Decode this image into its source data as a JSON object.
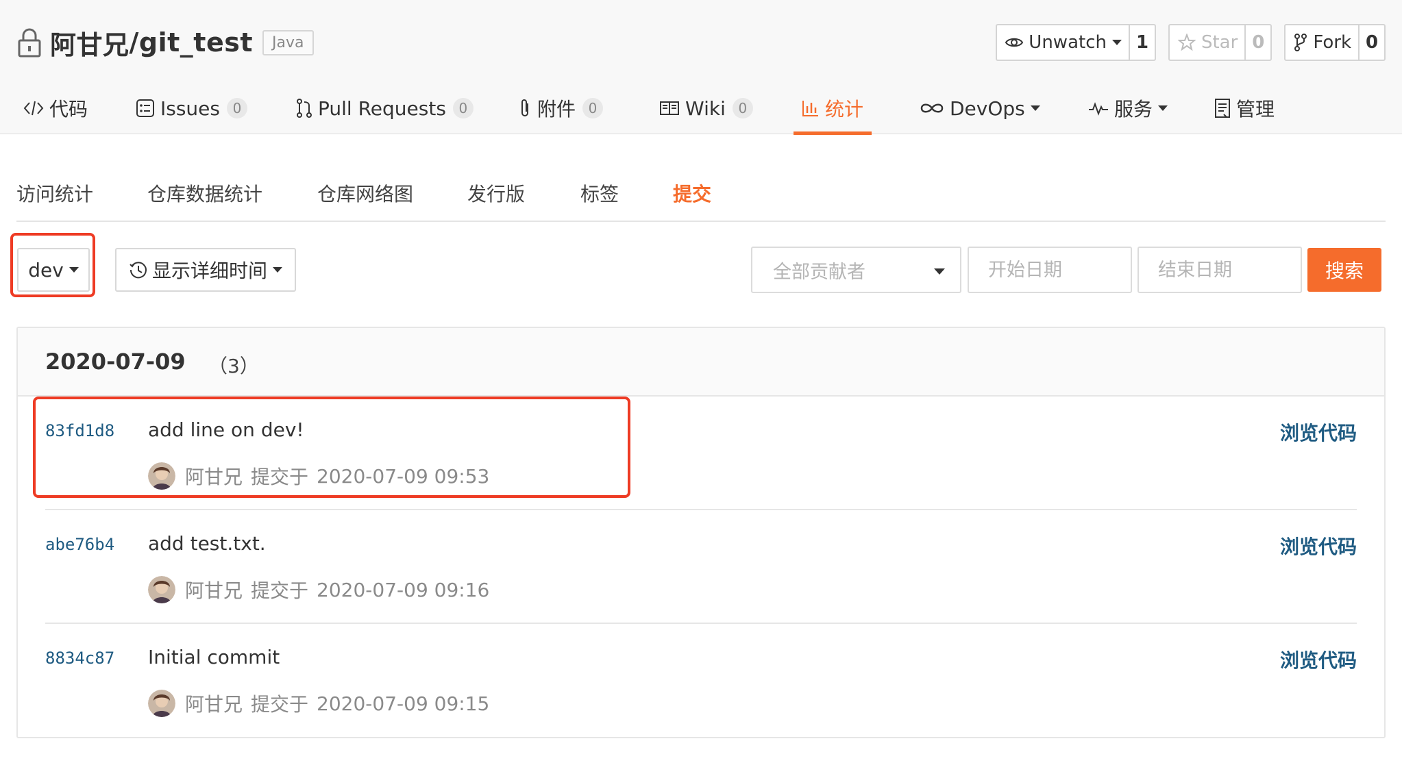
{
  "repo": {
    "owner": "阿甘兄",
    "separator": " / ",
    "name": "git_test",
    "language": "Java"
  },
  "actions": {
    "watch": {
      "label": "Unwatch",
      "count": "1"
    },
    "star": {
      "label": "Star",
      "count": "0"
    },
    "fork": {
      "label": "Fork",
      "count": "0"
    }
  },
  "tabs": [
    {
      "label": "代码",
      "icon": "code-icon"
    },
    {
      "label": "Issues",
      "badge": "0",
      "icon": "issues-icon"
    },
    {
      "label": "Pull Requests",
      "badge": "0",
      "icon": "pull-request-icon"
    },
    {
      "label": "附件",
      "badge": "0",
      "icon": "paperclip-icon"
    },
    {
      "label": "Wiki",
      "badge": "0",
      "icon": "book-icon"
    },
    {
      "label": "统计",
      "icon": "bar-chart-icon",
      "active": true
    },
    {
      "label": "DevOps",
      "icon": "infinity-icon"
    },
    {
      "label": "服务",
      "icon": "pulse-icon"
    },
    {
      "label": "管理",
      "icon": "document-icon"
    }
  ],
  "subnav": [
    "访问统计",
    "仓库数据统计",
    "仓库网络图",
    "发行版",
    "标签",
    "提交"
  ],
  "toolbar": {
    "branch": "dev",
    "time_toggle": "显示详细时间",
    "contributors_placeholder": "全部贡献者",
    "start_date_placeholder": "开始日期",
    "end_date_placeholder": "结束日期",
    "search_label": "搜索"
  },
  "commit_group": {
    "date": "2020-07-09",
    "count": "（3）",
    "commits": [
      {
        "sha": "83fd1d8",
        "message": "add line on dev!",
        "author": "阿甘兄",
        "committed_label": "提交于",
        "time": "2020-07-09 09:53",
        "browse": "浏览代码"
      },
      {
        "sha": "abe76b4",
        "message": "add test.txt.",
        "author": "阿甘兄",
        "committed_label": "提交于",
        "time": "2020-07-09 09:16",
        "browse": "浏览代码"
      },
      {
        "sha": "8834c87",
        "message": "Initial commit",
        "author": "阿甘兄",
        "committed_label": "提交于",
        "time": "2020-07-09 09:15",
        "browse": "浏览代码"
      }
    ]
  },
  "colors": {
    "accent": "#f56c2c",
    "link": "#1f5b82",
    "highlight": "#ee3b24"
  }
}
